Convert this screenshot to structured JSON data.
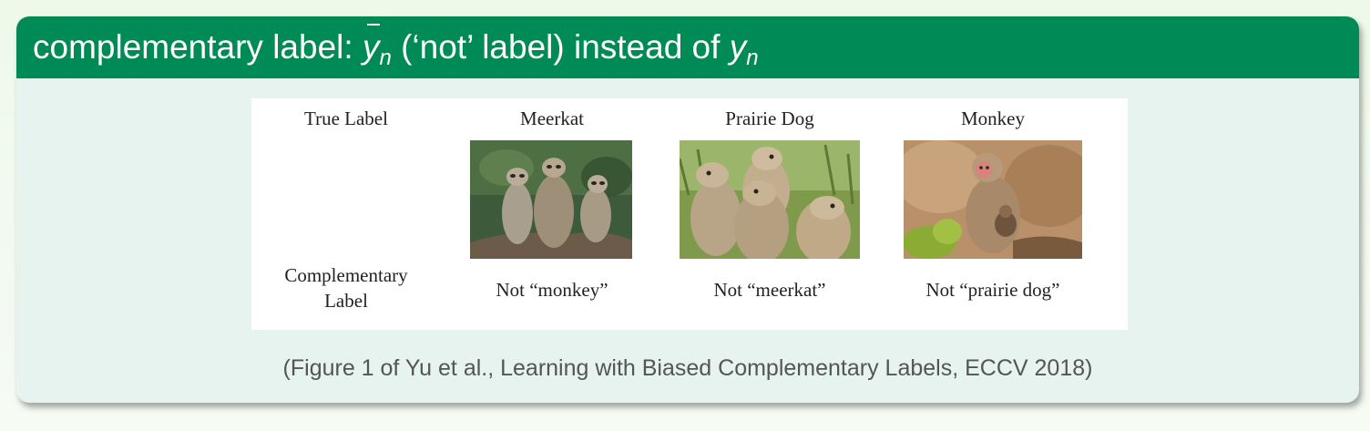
{
  "block": {
    "title_prefix": "complementary label: ",
    "title_ybar_var": "y",
    "title_ybar_sub": "n",
    "title_middle": " (‘not’ label) instead of ",
    "title_y_var": "y",
    "title_y_sub": "n"
  },
  "figure": {
    "true_label_heading": "True Label",
    "complementary_heading_line1": "Complementary",
    "complementary_heading_line2": "Label",
    "columns": [
      {
        "true_label": "Meerkat",
        "complementary_label": "Not “monkey”",
        "image": "meerkat-photo"
      },
      {
        "true_label": "Prairie Dog",
        "complementary_label": "Not “meerkat”",
        "image": "prairie-dog-photo"
      },
      {
        "true_label": "Monkey",
        "complementary_label": "Not “prairie dog”",
        "image": "monkey-photo"
      }
    ]
  },
  "caption": "(Figure 1 of Yu et al., Learning with Biased Complementary Labels, ECCV 2018)"
}
